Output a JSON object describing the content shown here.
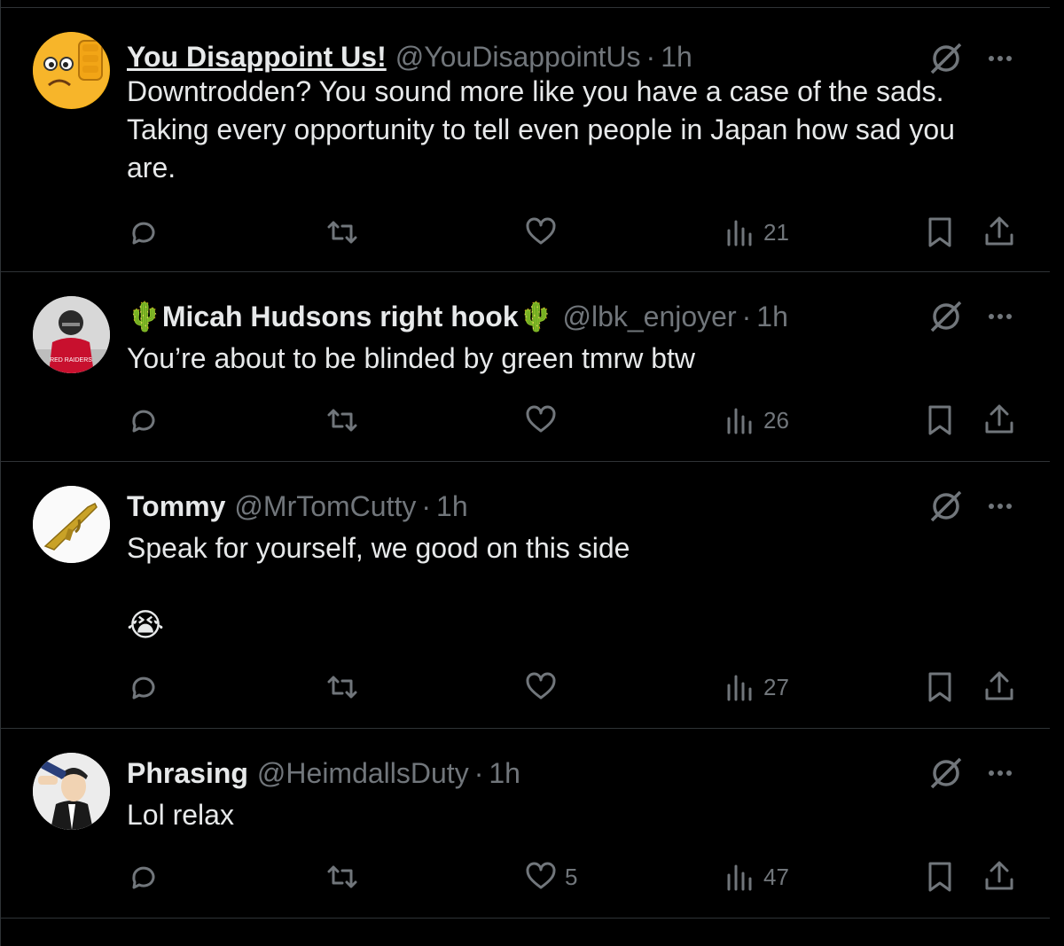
{
  "tweets": [
    {
      "name": "You Disappoint Us!",
      "handle": "@YouDisappointUs",
      "dot": "·",
      "time": "1h",
      "lines": [
        "Downtrodden? You sound more like you have a case of the sads.",
        "Taking every opportunity to tell even people in Japan how sad you",
        "are."
      ],
      "views": "21",
      "likes": ""
    },
    {
      "name": "🌵Micah Hudsons right hook🌵",
      "handle": "@lbk_enjoyer",
      "dot": "·",
      "time": "1h",
      "lines": [
        "You’re about to be blinded by green tmrw btw"
      ],
      "views": "26",
      "likes": ""
    },
    {
      "name": "Tommy",
      "handle": "@MrTomCutty",
      "dot": "·",
      "time": "1h",
      "lines": [
        "Speak for yourself, we good on this side"
      ],
      "emoji": "😭",
      "views": "27",
      "likes": ""
    },
    {
      "name": "Phrasing",
      "handle": "@HeimdallsDuty",
      "dot": "·",
      "time": "1h",
      "lines": [
        "Lol relax"
      ],
      "views": "47",
      "likes": "5"
    }
  ],
  "avatar_icons": [
    "thumbs-down-emoji-icon",
    "football-player-icon",
    "golden-rifle-icon",
    "cartoon-drinking-icon"
  ],
  "colors": {
    "background": "#000000",
    "text": "#e7e9ea",
    "muted": "#71767b",
    "divider": "#2f3336"
  }
}
